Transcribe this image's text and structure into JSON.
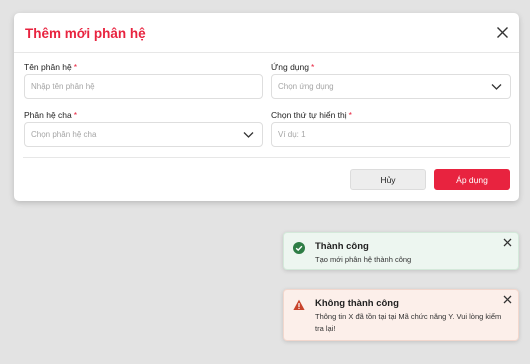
{
  "modal": {
    "title": "Thêm mới phân hệ",
    "fields": {
      "name": {
        "label": "Tên phân hệ",
        "required": "*",
        "placeholder": "Nhập tên phân hệ"
      },
      "app": {
        "label": "Ứng dụng",
        "required": "*",
        "placeholder": "Chọn ứng dụng"
      },
      "parent": {
        "label": "Phân hệ cha",
        "required": "*",
        "placeholder": "Chọn phân hệ cha"
      },
      "order": {
        "label": "Chọn thứ tự hiển thị",
        "required": "*",
        "placeholder": "Ví dụ: 1"
      }
    },
    "buttons": {
      "cancel": "Hủy",
      "apply": "Áp dụng"
    }
  },
  "toasts": {
    "success": {
      "title": "Thành công",
      "message": "Tạo mới phân hệ thành công"
    },
    "error": {
      "title": "Không thành công",
      "message": "Thông tin X đã tồn tại tại Mã chức năng Y. Vui lòng kiểm tra lại!"
    }
  },
  "colors": {
    "accent": "#e8233f",
    "success": "#2e7d45",
    "warning": "#c8432b"
  },
  "icons": {
    "close": "close-icon",
    "dropdown": "chevron-down-icon",
    "success": "check-circle-icon",
    "error": "warning-triangle-icon"
  }
}
